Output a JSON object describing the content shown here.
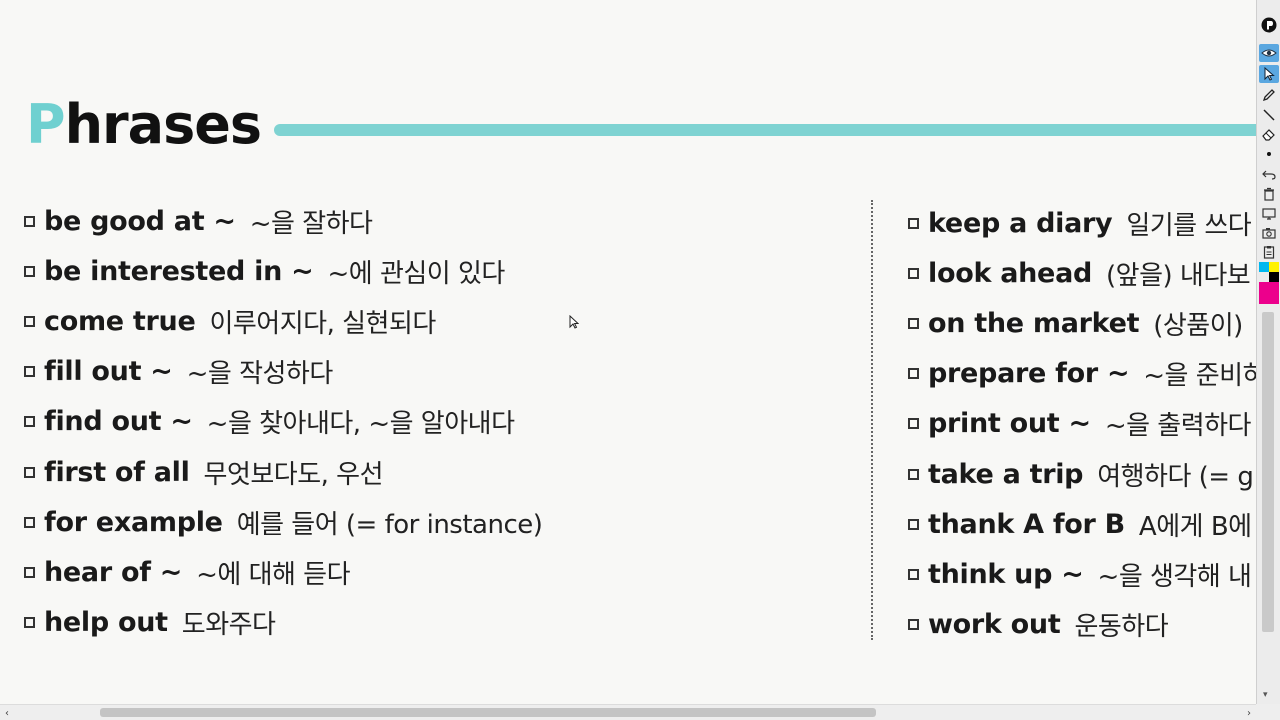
{
  "title": {
    "first_letter": "P",
    "rest": "hrases"
  },
  "phrases_left": [
    {
      "en": "be good at ~",
      "ko": "~을 잘하다"
    },
    {
      "en": "be interested in ~",
      "ko": "~에 관심이 있다"
    },
    {
      "en": "come true",
      "ko": "이루어지다, 실현되다"
    },
    {
      "en": "fill out ~",
      "ko": "~을 작성하다"
    },
    {
      "en": "find out ~",
      "ko": "~을 찾아내다, ~을 알아내다"
    },
    {
      "en": "first of all",
      "ko": "무엇보다도, 우선"
    },
    {
      "en": "for example",
      "ko": "예를 들어 (= for instance)"
    },
    {
      "en": "hear of ~",
      "ko": "~에 대해 듣다"
    },
    {
      "en": "help out",
      "ko": "도와주다"
    }
  ],
  "phrases_right": [
    {
      "en": "keep a diary",
      "ko": "일기를 쓰다"
    },
    {
      "en": "look ahead",
      "ko": "(앞을) 내다보"
    },
    {
      "en": "on the market",
      "ko": "(상품이)"
    },
    {
      "en": "prepare for ~",
      "ko": "~을 준비하"
    },
    {
      "en": "print out ~",
      "ko": "~을 출력하다"
    },
    {
      "en": "take a trip",
      "ko": "여행하다 (= g"
    },
    {
      "en": "thank A for B",
      "ko": "A에게 B에"
    },
    {
      "en": "think up ~",
      "ko": "~을 생각해 내"
    },
    {
      "en": "work out",
      "ko": "운동하다"
    }
  ],
  "colors": {
    "accent_teal": "#7fd3d2",
    "title_text": "#111111",
    "active_tool": "#5aa7e0"
  },
  "toolbar": {
    "icons": [
      "app-logo-icon",
      "eye-icon",
      "pointer-icon",
      "pen-icon",
      "line-icon",
      "eraser-icon",
      "dot-icon",
      "undo-icon",
      "trash-icon",
      "clear-screen-icon",
      "camera-icon",
      "clipboard-icon"
    ],
    "swatches": [
      "#00b7ef",
      "#fff200",
      "#000000",
      "#ec008c"
    ]
  }
}
